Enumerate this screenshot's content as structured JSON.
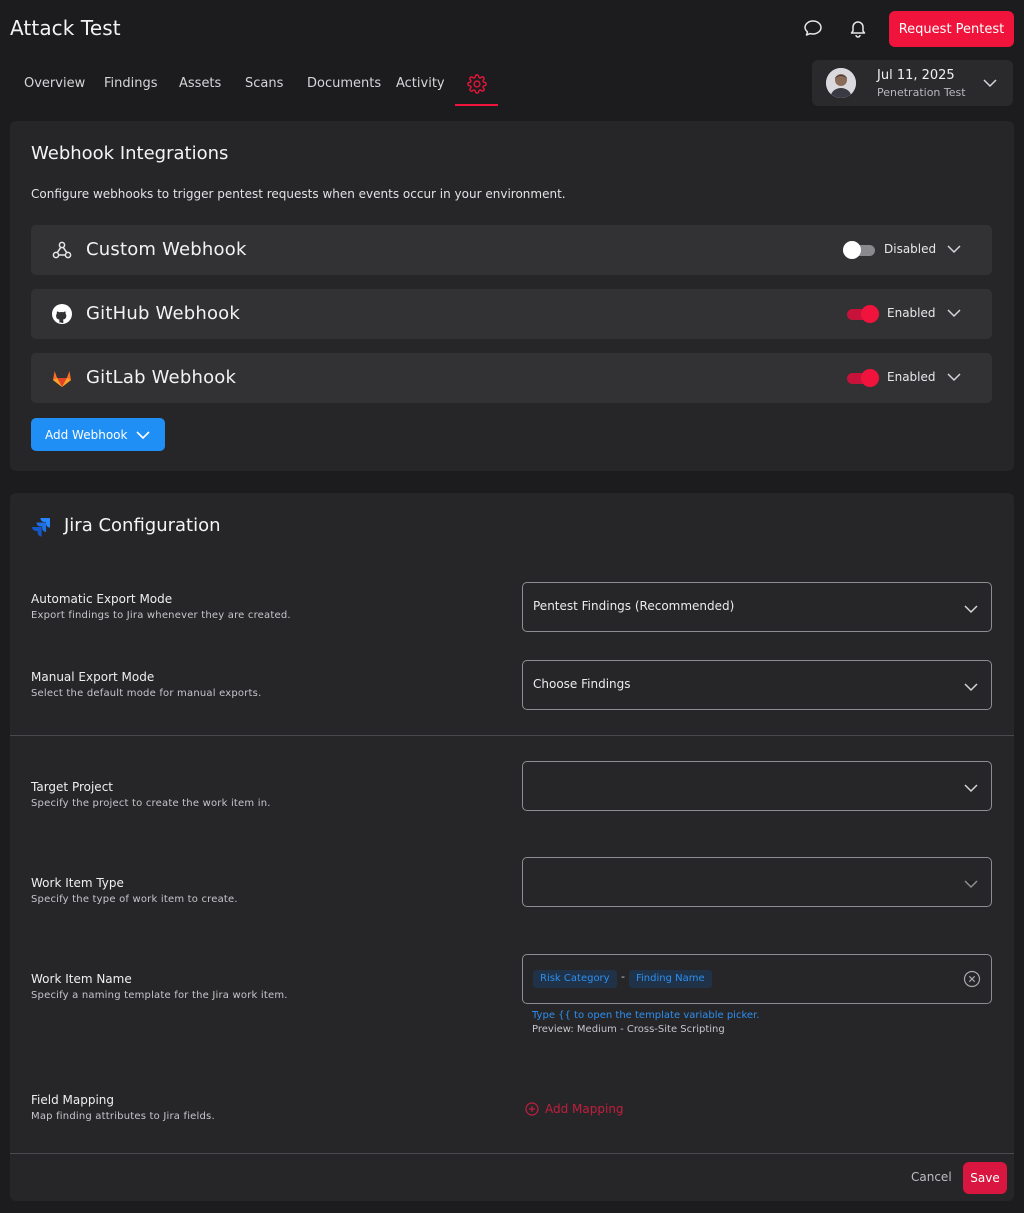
{
  "header": {
    "app_title": "Attack Test",
    "request_button": "Request Pentest",
    "icons": [
      "chat-icon",
      "bell-icon"
    ]
  },
  "tabs": [
    {
      "label": "Overview"
    },
    {
      "label": "Findings"
    },
    {
      "label": "Assets"
    },
    {
      "label": "Scans"
    },
    {
      "label": "Documents"
    },
    {
      "label": "Activity"
    },
    {
      "label": "",
      "icon": "settings-gear-icon",
      "active": true
    }
  ],
  "test_selector": {
    "date": "Jul 11, 2025",
    "type": "Penetration Test"
  },
  "webhooks": {
    "title": "Webhook Integrations",
    "description": "Configure webhooks to trigger pentest requests when events occur in your environment.",
    "items": [
      {
        "name": "Custom Webhook",
        "icon": "webhook-icon",
        "enabled": false,
        "status": "Disabled"
      },
      {
        "name": "GitHub Webhook",
        "icon": "github-icon",
        "enabled": true,
        "status": "Enabled"
      },
      {
        "name": "GitLab Webhook",
        "icon": "gitlab-icon",
        "enabled": true,
        "status": "Enabled"
      }
    ],
    "add_button": "Add Webhook"
  },
  "jira": {
    "title": "Jira Configuration",
    "fields": {
      "automatic_export": {
        "label": "Automatic Export Mode",
        "sub": "Export findings to Jira whenever they are created.",
        "value": "Pentest Findings (Recommended)"
      },
      "manual_export": {
        "label": "Manual Export Mode",
        "sub": "Select the default mode for manual exports.",
        "value": "Choose Findings"
      },
      "target_project": {
        "label": "Target Project",
        "sub": "Specify the project to create the work item in.",
        "value": ""
      },
      "work_item_type": {
        "label": "Work Item Type",
        "sub": "Specify the type of work item to create.",
        "value": ""
      },
      "work_item_name": {
        "label": "Work Item Name",
        "sub": "Specify a naming template for the Jira work item.",
        "chips": [
          "Risk Category",
          "Finding Name"
        ],
        "separator": "-",
        "hint": "Type {{ to open the template variable picker.",
        "preview": "Preview: Medium - Cross-Site Scripting"
      },
      "field_mapping": {
        "label": "Field Mapping",
        "sub": "Map finding attributes to Jira fields.",
        "add_button": "Add Mapping"
      }
    },
    "cancel": "Cancel",
    "save": "Save"
  },
  "colors": {
    "accent": "#f0143c",
    "primary_blue": "#1f8ff5",
    "background": "#1c1c1e",
    "card": "#262628"
  }
}
